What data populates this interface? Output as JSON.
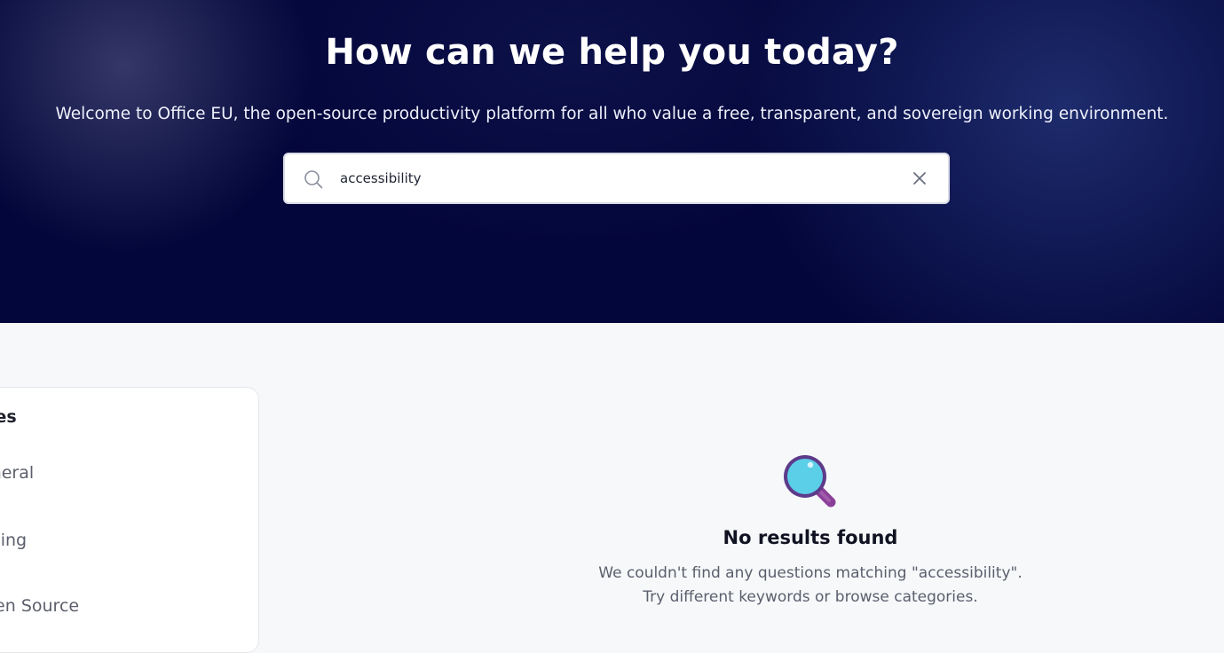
{
  "hero": {
    "title": "How can we help you today?",
    "subtitle": "Welcome to Office EU, the open-source productivity platform for all who value a free, transparent, and sovereign working environment.",
    "background_color": "#03063a"
  },
  "search": {
    "value": "accessibility",
    "icon": "search-icon",
    "clear_icon": "close-icon"
  },
  "sidebar": {
    "heading": "ies",
    "items": [
      {
        "label": "eneral"
      },
      {
        "label": "icing"
      },
      {
        "label": "pen Source"
      }
    ]
  },
  "empty_state": {
    "icon": "magnifying-glass-icon",
    "title": "No results found",
    "message_line1": "We couldn't find any questions matching \"accessibility\".",
    "message_line2": "Try different keywords or browse categories."
  }
}
